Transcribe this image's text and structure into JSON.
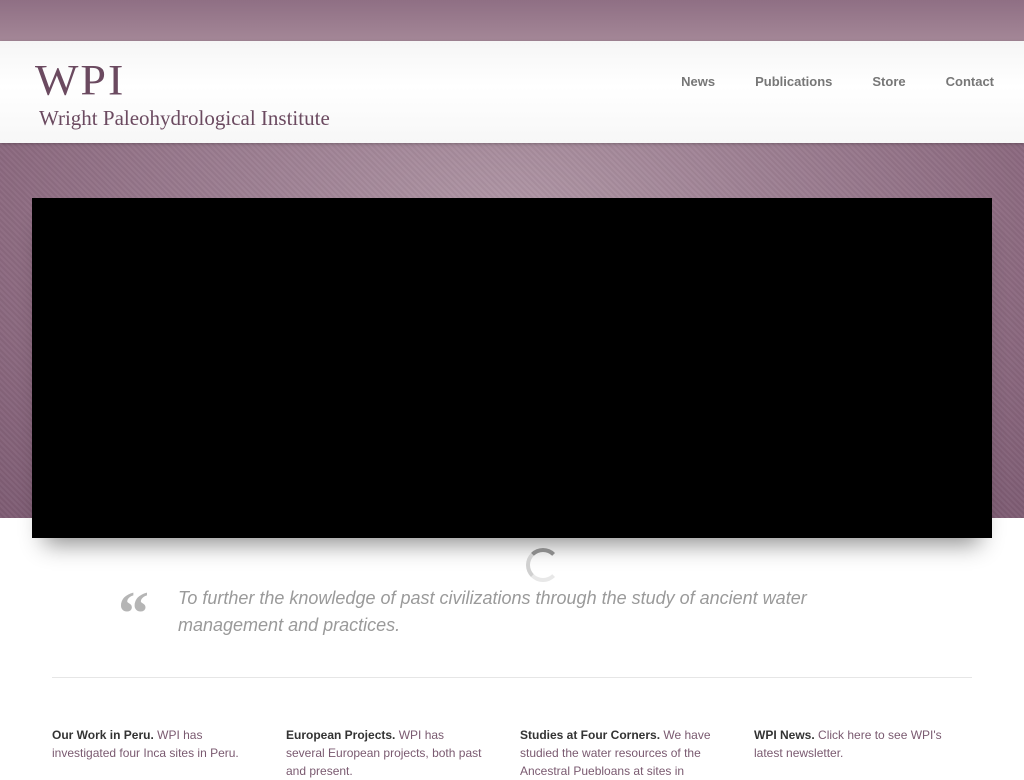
{
  "header": {
    "logo_abbr": "WPI",
    "logo_name": "Wright Paleohydrological Institute"
  },
  "nav": {
    "items": [
      {
        "label": "News"
      },
      {
        "label": "Publications"
      },
      {
        "label": "Store"
      },
      {
        "label": "Contact"
      }
    ]
  },
  "hero": {
    "state": "loading"
  },
  "mission": {
    "quote_mark": "“",
    "text": "To further the knowledge of past civilizations through the study of ancient water management and practices."
  },
  "columns": [
    {
      "title": "Our Work in Peru.",
      "text": " WPI has investigated four Inca sites in Peru."
    },
    {
      "title": "European Projects.",
      "text": " WPI has several European projects, both past and present."
    },
    {
      "title": "Studies at Four Corners.",
      "text": " We have studied the water resources of the Ancestral Puebloans at sites in"
    },
    {
      "title": "WPI News.",
      "text": " Click here to see WPI's latest newsletter."
    }
  ],
  "colors": {
    "brand": "#6b4a60",
    "band": "#8f6f84",
    "nav_text": "#777777",
    "link_text": "#7a5a70"
  }
}
